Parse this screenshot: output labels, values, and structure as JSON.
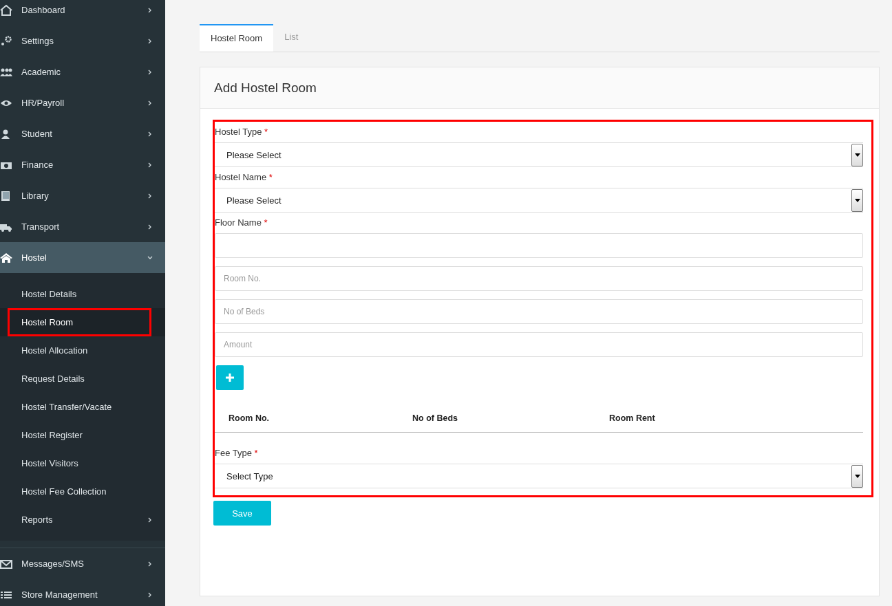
{
  "sidebar": {
    "items": [
      {
        "label": "Dashboard",
        "expanded": false
      },
      {
        "label": "Settings",
        "expanded": false
      },
      {
        "label": "Academic",
        "expanded": false
      },
      {
        "label": "HR/Payroll",
        "expanded": false
      },
      {
        "label": "Student",
        "expanded": false
      },
      {
        "label": "Finance",
        "expanded": false
      },
      {
        "label": "Library",
        "expanded": false
      },
      {
        "label": "Transport",
        "expanded": false
      },
      {
        "label": "Hostel",
        "expanded": true,
        "children": [
          {
            "label": "Hostel Details",
            "kind": "link",
            "selected": false,
            "highlighted": false
          },
          {
            "label": "Hostel Room",
            "kind": "link",
            "selected": true,
            "highlighted": true
          },
          {
            "label": "Hostel Allocation",
            "kind": "link",
            "selected": false,
            "highlighted": false
          },
          {
            "label": "Request Details",
            "kind": "link",
            "selected": false,
            "highlighted": false
          },
          {
            "label": "Hostel Transfer/Vacate",
            "kind": "link",
            "selected": false,
            "highlighted": false
          },
          {
            "label": "Hostel Register",
            "kind": "link",
            "selected": false,
            "highlighted": false
          },
          {
            "label": "Hostel Visitors",
            "kind": "link",
            "selected": false,
            "highlighted": false
          },
          {
            "label": "Hostel Fee Collection",
            "kind": "link",
            "selected": false,
            "highlighted": false
          },
          {
            "label": "Reports",
            "kind": "submenu",
            "selected": false,
            "highlighted": false
          }
        ]
      },
      {
        "label": "Messages/SMS",
        "expanded": false
      },
      {
        "label": "Store Management",
        "expanded": false
      }
    ]
  },
  "tabs": [
    {
      "label": "Hostel Room",
      "selected": true
    },
    {
      "label": "List",
      "selected": false
    }
  ],
  "panel": {
    "title": "Add Hostel Room",
    "highlighted": true,
    "fields": [
      {
        "kind": "select",
        "label": "Hostel Type",
        "required_mark": "*",
        "value": "Please Select"
      },
      {
        "kind": "select",
        "label": "Hostel Name",
        "required_mark": "*",
        "value": "Please Select"
      },
      {
        "kind": "input",
        "label": "Floor Name",
        "required_mark": "*"
      },
      {
        "kind": "input",
        "placeholder": "Room No."
      },
      {
        "kind": "input",
        "placeholder": "No of Beds"
      },
      {
        "kind": "input",
        "placeholder": "Amount"
      }
    ],
    "room_table": {
      "columns": [
        "Room No.",
        "No of Beds",
        "Room Rent"
      ]
    },
    "fee_field": {
      "kind": "select",
      "label": "Fee Type",
      "required_mark": "*",
      "value": "Select Type"
    },
    "save_button": "Save"
  }
}
